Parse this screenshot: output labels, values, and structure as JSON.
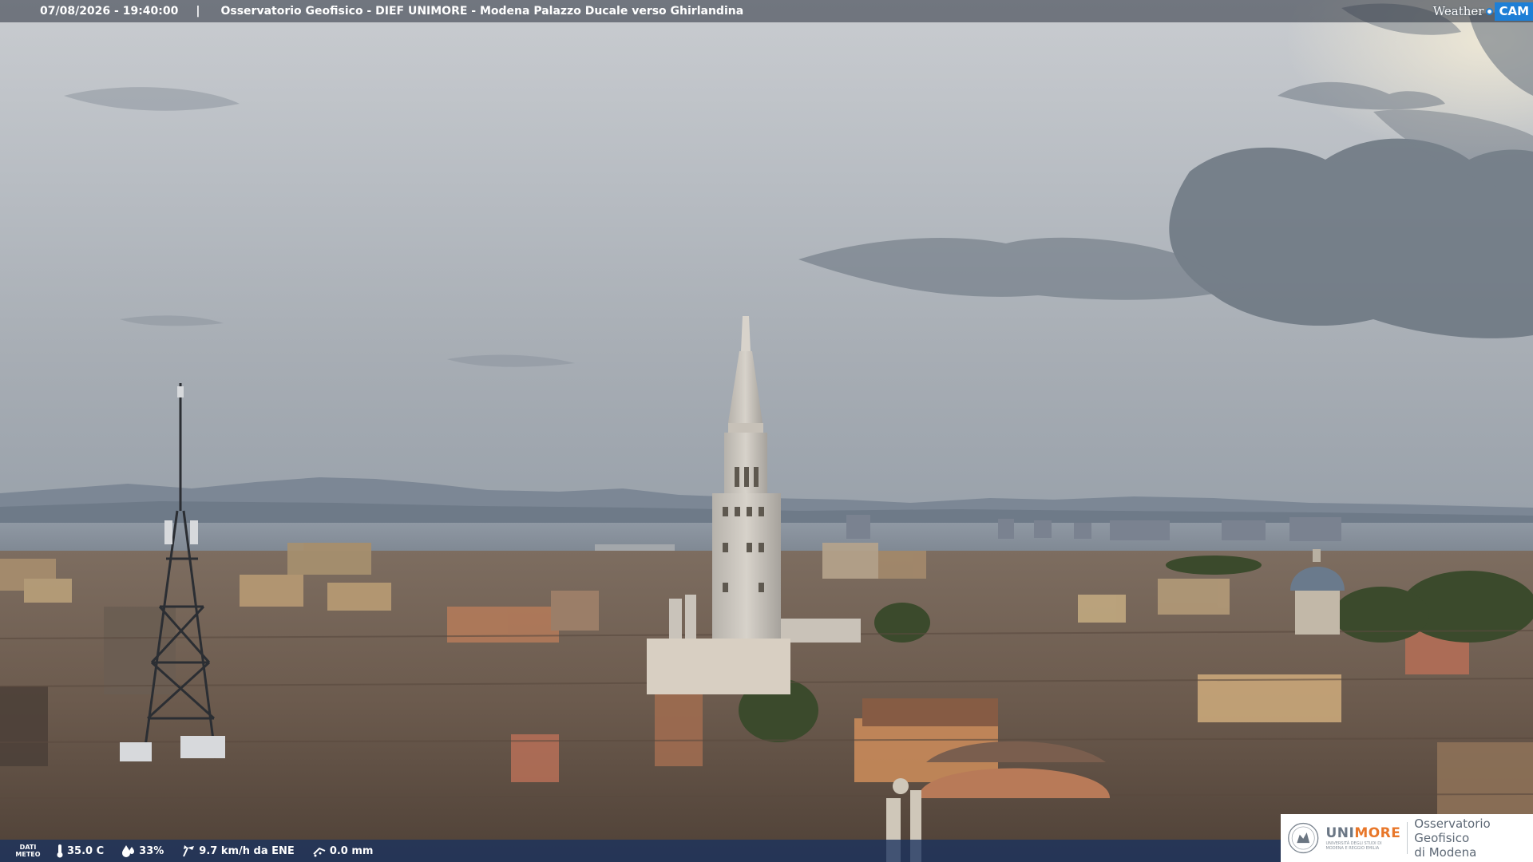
{
  "overlay": {
    "datetime": "07/08/2026 - 19:40:00",
    "separator": "|",
    "caption": "Osservatorio Geofisico - DIEF UNIMORE - Modena Palazzo Ducale verso Ghirlandina"
  },
  "provider_logo": {
    "weather": "Weather",
    "cam": "CAM",
    "accent": "#1e7fd6"
  },
  "weather_strip": {
    "label_line1": "DATI",
    "label_line2": "METEO",
    "temperature": "35.0 C",
    "humidity": "33%",
    "wind": "9.7 km/h da ENE",
    "rain": "0.0 mm",
    "icons": [
      "thermometer-icon",
      "humidity-drop-icon",
      "wind-icon",
      "rain-icon"
    ]
  },
  "institution_logo": {
    "uni": "UNI",
    "more": "MORE",
    "uni_subtitle": "UNIVERSITÀ DEGLI STUDI DI MODENA E REGGIO EMILIA",
    "osservatorio_line1": "Osservatorio Geofisico",
    "osservatorio_line2": "di Modena",
    "accent": "#e8772a"
  }
}
